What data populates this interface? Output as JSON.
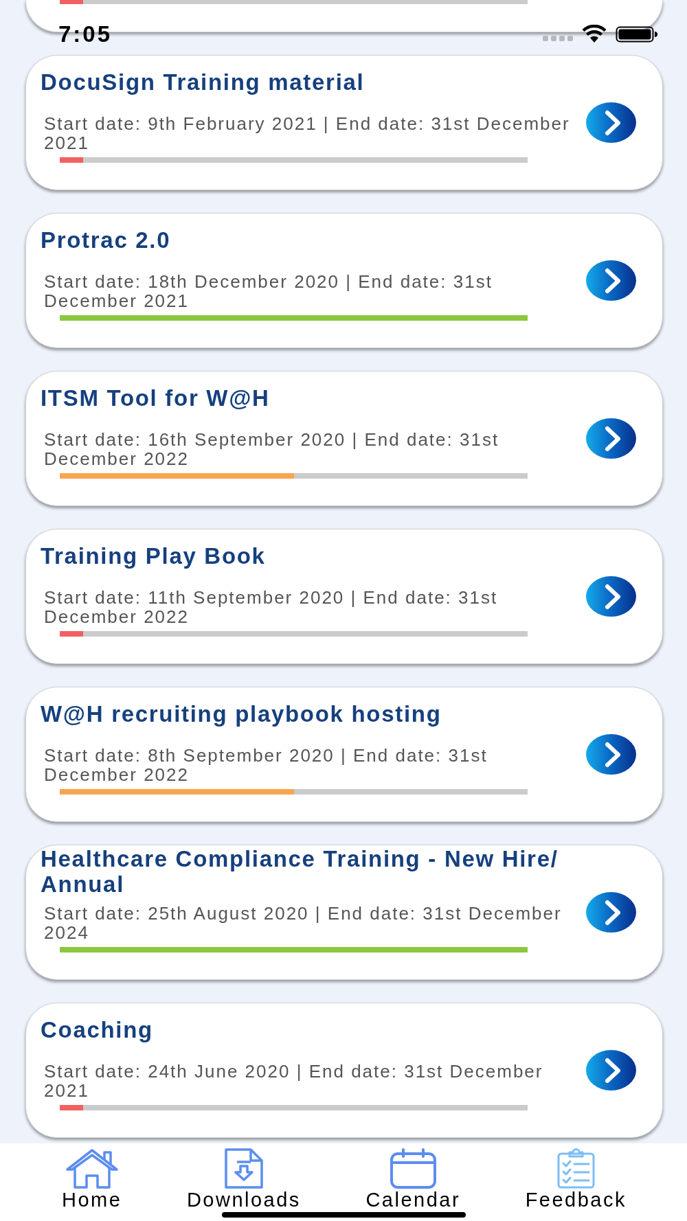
{
  "status_bar": {
    "time": "7:05"
  },
  "cut_off_card": {
    "level": 0.05,
    "color": "#f26161"
  },
  "trainings": [
    {
      "title": "DocuSign Training material",
      "dates": "Start date: 9th February 2021 | End date: 31st December 2021",
      "level": 0.05,
      "color": "#f26161"
    },
    {
      "title": "Protrac 2.0",
      "dates": "Start date: 18th December 2020 | End date: 31st December 2021",
      "level": 1,
      "color": "#8dc63f"
    },
    {
      "title": "ITSM Tool for W@H",
      "dates": "Start date: 16th September 2020 | End date: 31st December 2022",
      "level": 0.5,
      "color": "#f9a54f"
    },
    {
      "title": "Training Play Book",
      "dates": "Start date: 11th September 2020 | End date: 31st December 2022",
      "level": 0.05,
      "color": "#f26161"
    },
    {
      "title": "W@H recruiting playbook hosting",
      "dates": "Start date: 8th September 2020 | End date: 31st December 2022",
      "level": 0.5,
      "color": "#f9a54f"
    },
    {
      "title": "Healthcare Compliance Training - New Hire/ Annual",
      "dates": "Start date: 25th August 2020 | End date: 31st December 2024",
      "level": 1,
      "color": "#8dc63f"
    },
    {
      "title": "Coaching",
      "dates": "Start date: 24th June 2020 | End date: 31st December 2021",
      "level": 0.05,
      "color": "#f26161"
    }
  ],
  "tab_bar": {
    "tabs": [
      {
        "label": "Home"
      },
      {
        "label": "Downloads"
      },
      {
        "label": "Calendar"
      },
      {
        "label": "Feedback"
      }
    ]
  }
}
